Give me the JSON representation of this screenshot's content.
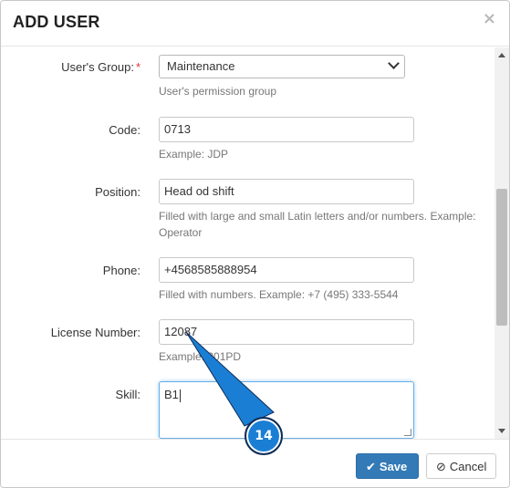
{
  "modal": {
    "title": "ADD USER",
    "close_symbol": "×"
  },
  "fields": {
    "users_group": {
      "label": "User's Group:",
      "required_mark": "*",
      "selected": "Maintenance",
      "help": "User's permission group"
    },
    "code": {
      "label": "Code:",
      "value": "0713",
      "help": "Example: JDP"
    },
    "position": {
      "label": "Position:",
      "value": "Head od shift",
      "help": "Filled with large and small Latin letters and/or numbers. Example: Operator"
    },
    "phone": {
      "label": "Phone:",
      "value": "+4568585888954",
      "help": "Filled with numbers. Example: +7 (495) 333-5544"
    },
    "license_number": {
      "label": "License Number:",
      "value": "12087",
      "help": "Example: 201PD"
    },
    "skill": {
      "label": "Skill:",
      "value": "B1"
    }
  },
  "footer": {
    "save_label": "Save",
    "cancel_label": "Cancel"
  },
  "callout": {
    "number": "14",
    "color": "#1a7fd4"
  },
  "icons": {
    "save": "check-icon",
    "cancel": "ban-icon",
    "select": "chevron-down-icon",
    "close": "close-icon"
  }
}
